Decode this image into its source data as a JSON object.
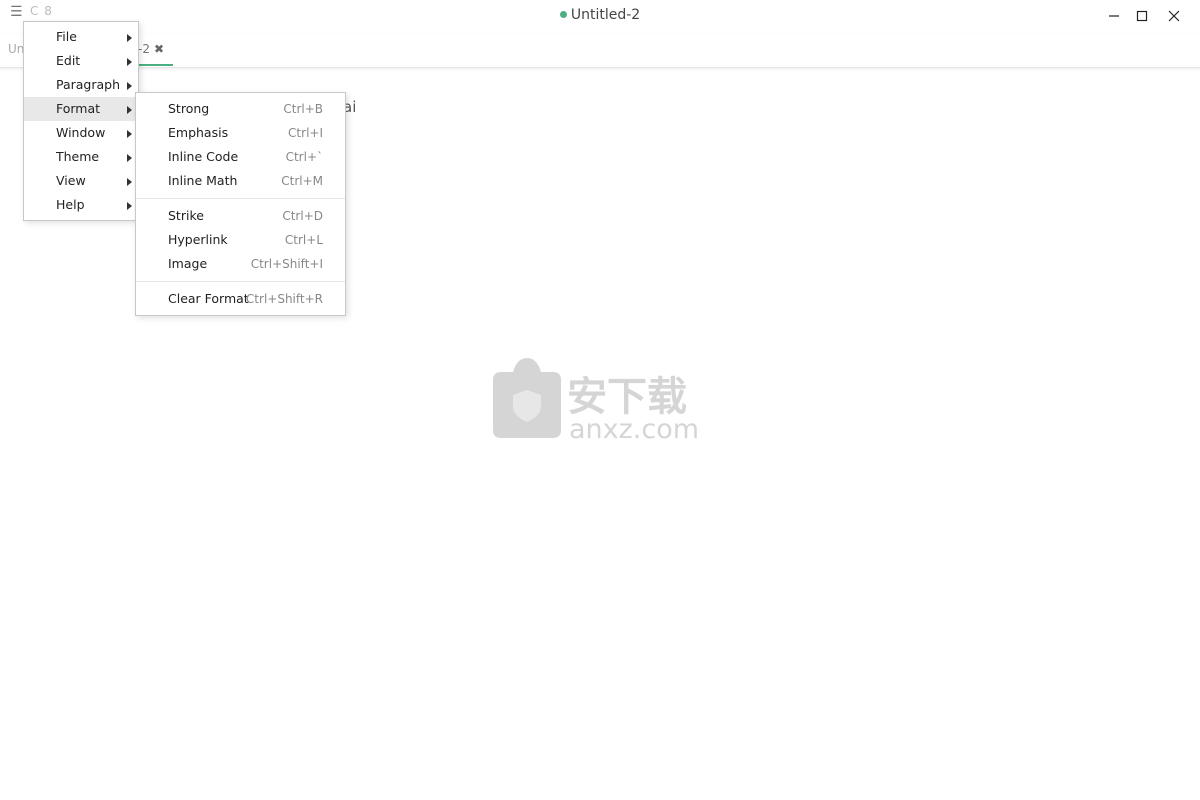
{
  "titlebar": {
    "menu_glyph": "☰",
    "extra_text": "C 8",
    "title": "Untitled-2",
    "status_dot_color": "#4caf81"
  },
  "tabs": {
    "first_label": "Un",
    "active_label": "-2",
    "close_glyph": "✖",
    "accent_color": "#4caf81"
  },
  "editor": {
    "visible_text": "ai"
  },
  "main_menu": {
    "items": [
      {
        "label": "File"
      },
      {
        "label": "Edit"
      },
      {
        "label": "Paragraph"
      },
      {
        "label": "Format"
      },
      {
        "label": "Window"
      },
      {
        "label": "Theme"
      },
      {
        "label": "View"
      },
      {
        "label": "Help"
      }
    ],
    "active_item": "Format"
  },
  "format_menu": {
    "items": [
      {
        "label": "Strong",
        "shortcut": "Ctrl+B"
      },
      {
        "label": "Emphasis",
        "shortcut": "Ctrl+I"
      },
      {
        "label": "Inline Code",
        "shortcut": "Ctrl+`"
      },
      {
        "label": "Inline Math",
        "shortcut": "Ctrl+M"
      },
      {
        "label": "Strike",
        "shortcut": "Ctrl+D"
      },
      {
        "label": "Hyperlink",
        "shortcut": "Ctrl+L"
      },
      {
        "label": "Image",
        "shortcut": "Ctrl+Shift+I"
      },
      {
        "label": "Clear Format",
        "shortcut": "Ctrl+Shift+R"
      }
    ]
  },
  "watermark": {
    "cn_text": "安下载",
    "domain": "anxz.com"
  },
  "window_controls": {
    "minimize": "minimize-icon",
    "maximize": "maximize-icon",
    "close": "close-icon"
  }
}
